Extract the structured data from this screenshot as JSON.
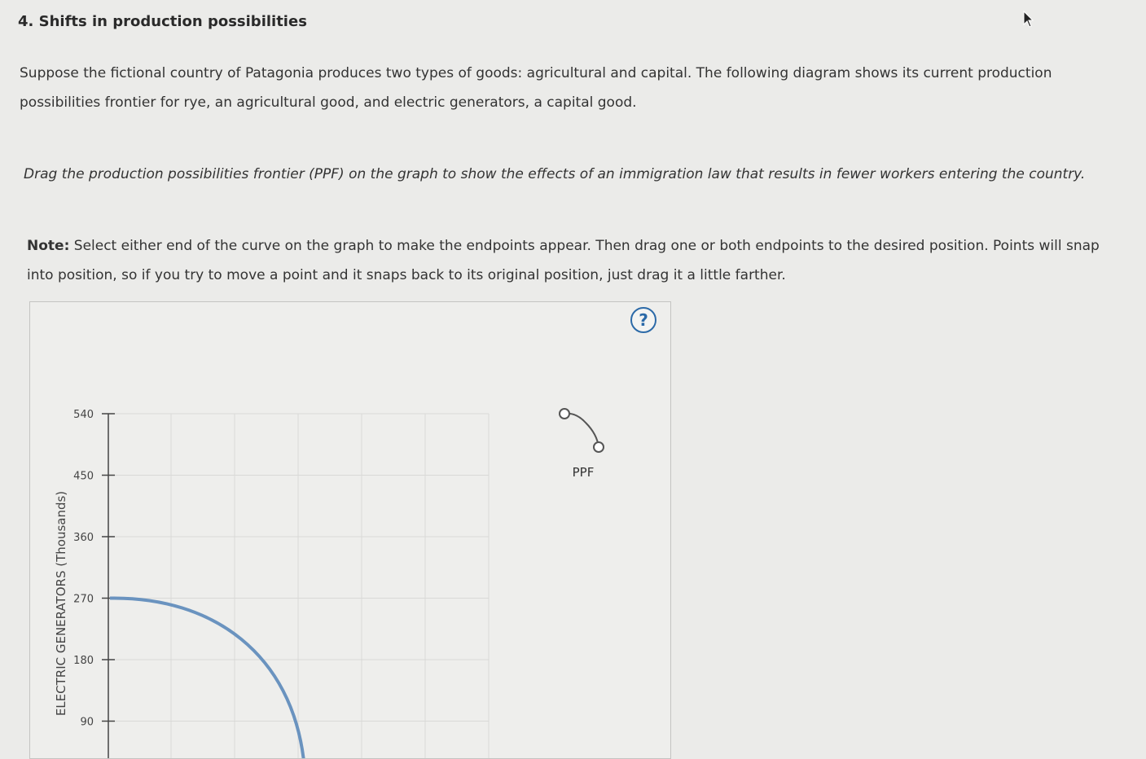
{
  "question": {
    "title": "4. Shifts in production possibilities",
    "intro": "Suppose the fictional country of Patagonia produces two types of goods: agricultural and capital. The following diagram shows its current production possibilities frontier for rye, an agricultural good, and electric generators, a capital good.",
    "instruction": "Drag the production possibilities frontier (PPF) on the graph to show the effects of an immigration law that results in fewer workers entering the country.",
    "note_label": "Note:",
    "note_text": " Select either end of the curve on the graph to make the endpoints appear. Then drag one or both endpoints to the desired position. Points will snap into position, so if you try to move a point and it snaps back to its original position, just drag it a little farther."
  },
  "graph": {
    "help_label": "?",
    "y_axis_label": "ELECTRIC GENERATORS (Thousands)",
    "legend_label": "PPF",
    "colors": {
      "curve": "#6a93bf",
      "help": "#2c6aa8"
    }
  },
  "chart_data": {
    "type": "line",
    "ylabel": "ELECTRIC GENERATORS (Thousands)",
    "yticks": [
      90,
      180,
      270,
      360,
      450,
      540
    ],
    "ylim": [
      0,
      540
    ],
    "series": [
      {
        "name": "PPF",
        "y_intercept": 270
      }
    ]
  }
}
